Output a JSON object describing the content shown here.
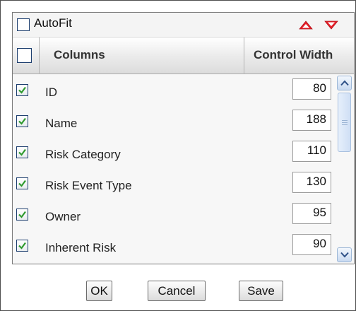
{
  "toolbar": {
    "autofit_label": "AutoFit",
    "autofit_checked": false,
    "move_up_icon": "triangle-up-icon",
    "move_down_icon": "triangle-down-icon"
  },
  "grid": {
    "select_all_checked": false,
    "columns_header": "Columns",
    "width_header": "Control Width",
    "rows": [
      {
        "checked": true,
        "label": "ID",
        "width": "80"
      },
      {
        "checked": true,
        "label": "Name",
        "width": "188"
      },
      {
        "checked": true,
        "label": "Risk Category",
        "width": "110"
      },
      {
        "checked": true,
        "label": "Risk Event Type",
        "width": "130"
      },
      {
        "checked": true,
        "label": "Owner",
        "width": "95"
      },
      {
        "checked": true,
        "label": "Inherent Risk",
        "width": "90"
      }
    ]
  },
  "buttons": {
    "ok": "OK",
    "cancel": "Cancel",
    "save": "Save"
  },
  "colors": {
    "arrow_red": "#e8202a",
    "check_green": "#2e9a2e",
    "scroll_blue": "#c9daf1"
  }
}
